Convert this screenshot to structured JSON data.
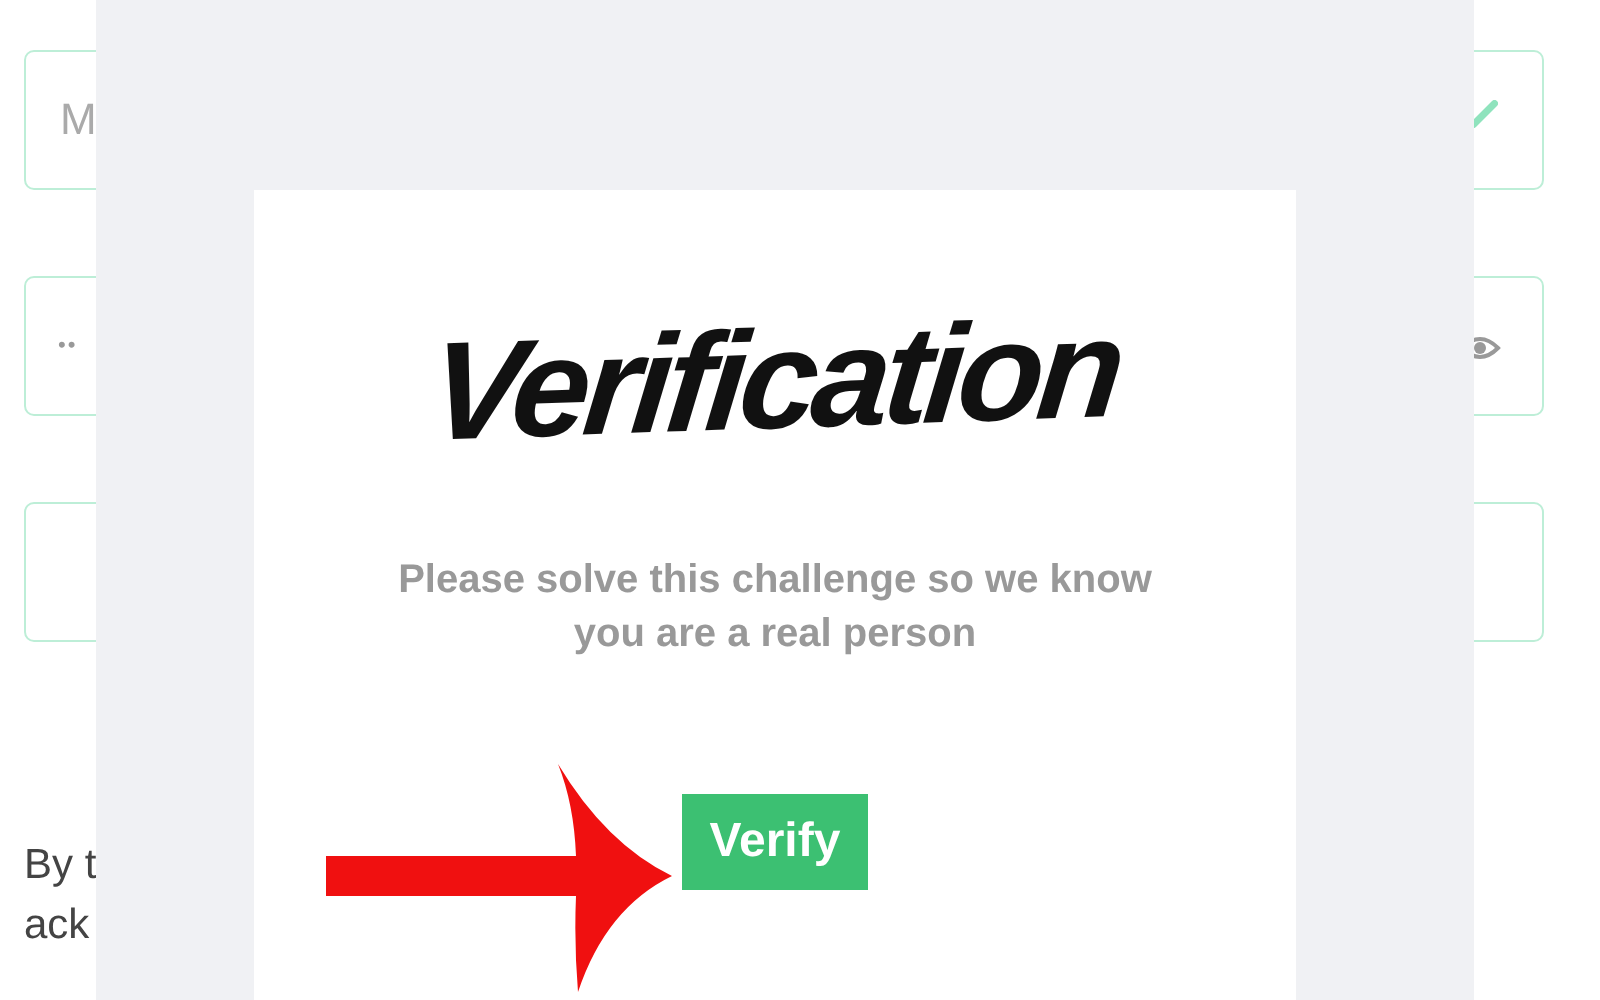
{
  "form": {
    "fields": [
      {
        "kind": "text",
        "placeholder": "M",
        "valid": true
      },
      {
        "kind": "password",
        "value": "••"
      },
      {
        "kind": "text"
      }
    ],
    "notice_lines": [
      "By t",
      "ack"
    ]
  },
  "modal": {
    "captcha": "Verification",
    "message": "Please solve this challenge so we know you are a real person",
    "button": "Verify"
  }
}
